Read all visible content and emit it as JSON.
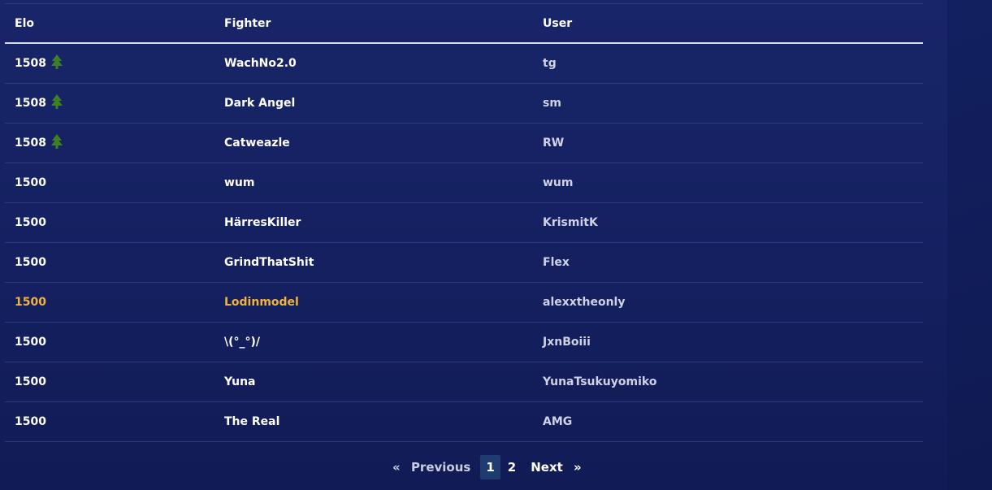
{
  "table": {
    "headers": {
      "elo": "Elo",
      "fighter": "Fighter",
      "user": "User"
    },
    "rows": [
      {
        "elo": "1508",
        "trend": "up",
        "fighter": "WachNo2.0",
        "user": "tg"
      },
      {
        "elo": "1508",
        "trend": "up",
        "fighter": "Dark Angel",
        "user": "sm"
      },
      {
        "elo": "1508",
        "trend": "up",
        "fighter": "Catweazle",
        "user": "RW"
      },
      {
        "elo": "1500",
        "trend": "none",
        "fighter": "wum",
        "user": "wum"
      },
      {
        "elo": "1500",
        "trend": "none",
        "fighter": "HärresKiller",
        "user": "KrismitK"
      },
      {
        "elo": "1500",
        "trend": "none",
        "fighter": "GrindThatShit",
        "user": "Flex"
      },
      {
        "elo": "1500",
        "trend": "none",
        "fighter": "Lodinmodel",
        "user": "alexxtheonly",
        "highlighted": true
      },
      {
        "elo": "1500",
        "trend": "none",
        "fighter": "\\(°_°)/",
        "user": "JxnBoiii"
      },
      {
        "elo": "1500",
        "trend": "none",
        "fighter": "Yuna",
        "user": "YunaTsukuyomiko"
      },
      {
        "elo": "1500",
        "trend": "none",
        "fighter": "The Real",
        "user": "AMG"
      }
    ]
  },
  "pagination": {
    "prev_arrow": "«",
    "prev_label": "Previous",
    "pages": [
      "1",
      "2"
    ],
    "current_page": "1",
    "next_label": "Next",
    "next_arrow": "»"
  },
  "icons": {
    "trend_up": "tree-up-icon"
  },
  "colors": {
    "background": "#142060",
    "highlight": "#f2b33d",
    "trend_up": "#3f7f25",
    "active_page": "#1f3c72"
  }
}
